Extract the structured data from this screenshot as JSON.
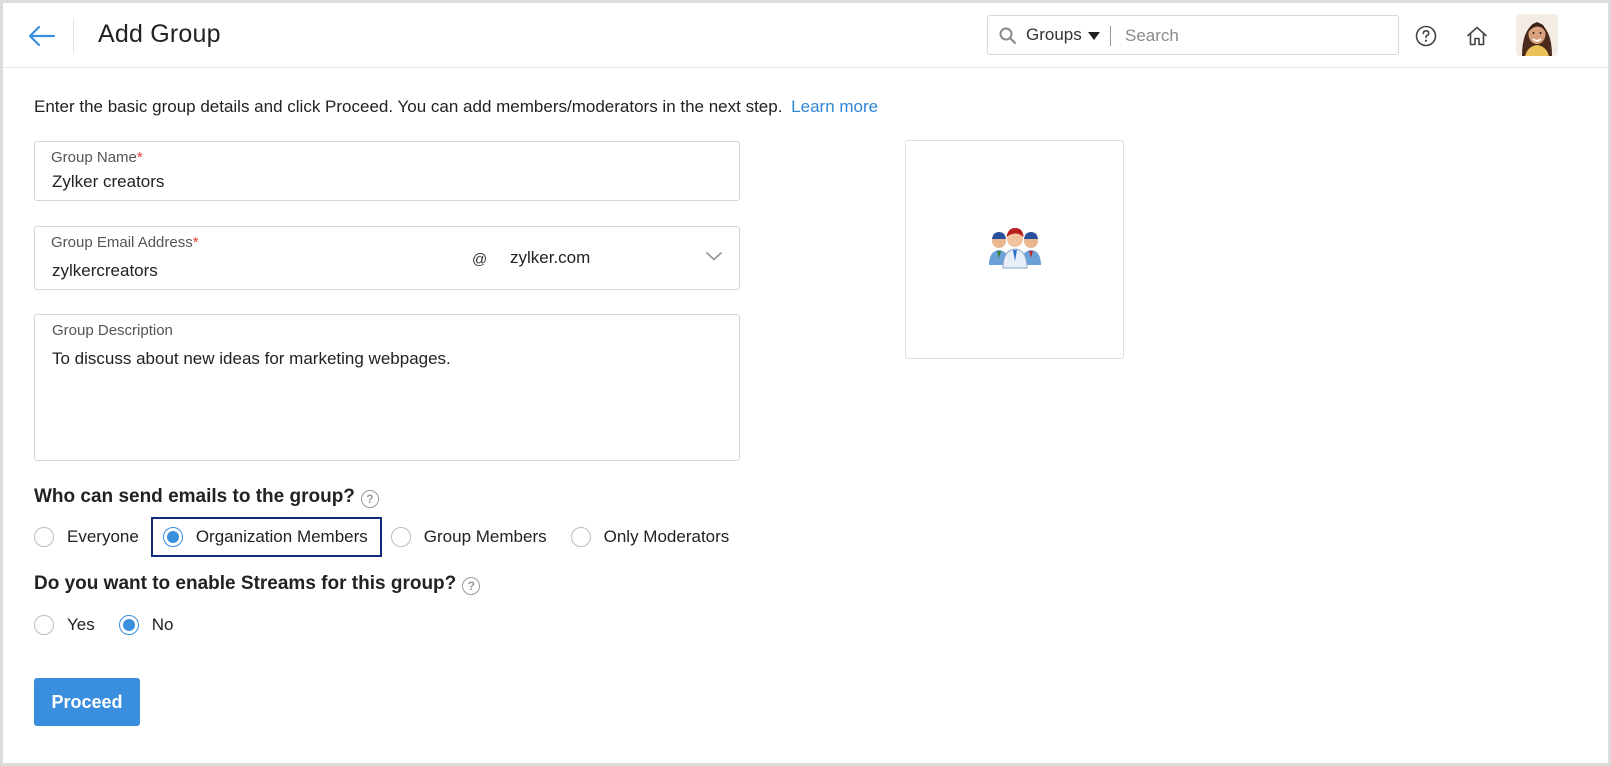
{
  "header": {
    "title": "Add Group",
    "search": {
      "scope": "Groups",
      "placeholder": "Search"
    },
    "icons": [
      "back-arrow-icon",
      "help-icon",
      "home-icon",
      "avatar"
    ]
  },
  "intro": {
    "text": "Enter the basic group details and click Proceed. You can add members/moderators in the next step.",
    "link": "Learn more"
  },
  "form": {
    "group_name": {
      "label": "Group Name",
      "required": "*",
      "value": "Zylker creators"
    },
    "group_email": {
      "label": "Group Email Address",
      "required": "*",
      "value": "zylkercreators",
      "at": "@",
      "domain": "zylker.com"
    },
    "description": {
      "label": "Group Description",
      "value": "To discuss about new ideas for marketing webpages."
    }
  },
  "send_permission": {
    "question": "Who can send emails to the group?",
    "help": "?",
    "options": [
      "Everyone",
      "Organization Members",
      "Group Members",
      "Only Moderators"
    ],
    "selected": "Organization Members"
  },
  "streams": {
    "question": "Do you want to enable Streams for this group?",
    "help": "?",
    "options": [
      "Yes",
      "No"
    ],
    "selected": "No"
  },
  "actions": {
    "proceed": "Proceed"
  },
  "colors": {
    "accent": "#3a8ede",
    "link": "#2f86d6",
    "highlight_border": "#0f2c7a",
    "required": "#e0403a"
  }
}
